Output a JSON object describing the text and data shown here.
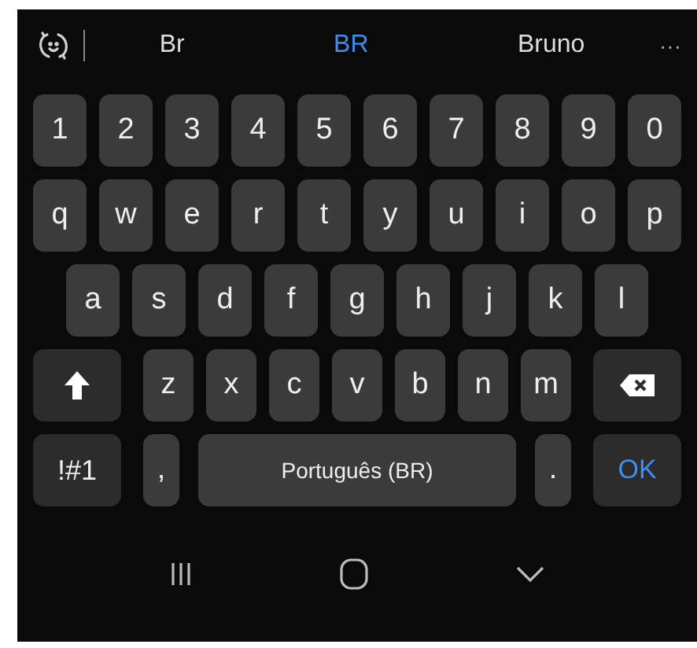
{
  "suggestions": [
    {
      "text": "Br",
      "selected": false
    },
    {
      "text": "BR",
      "selected": true
    },
    {
      "text": "Bruno",
      "selected": false
    }
  ],
  "more": "···",
  "rows": [
    {
      "indent": false,
      "keys": [
        {
          "kind": "char",
          "label": "1"
        },
        {
          "kind": "char",
          "label": "2"
        },
        {
          "kind": "char",
          "label": "3"
        },
        {
          "kind": "char",
          "label": "4"
        },
        {
          "kind": "char",
          "label": "5"
        },
        {
          "kind": "char",
          "label": "6"
        },
        {
          "kind": "char",
          "label": "7"
        },
        {
          "kind": "char",
          "label": "8"
        },
        {
          "kind": "char",
          "label": "9"
        },
        {
          "kind": "char",
          "label": "0"
        }
      ]
    },
    {
      "indent": false,
      "keys": [
        {
          "kind": "char",
          "label": "q"
        },
        {
          "kind": "char",
          "label": "w"
        },
        {
          "kind": "char",
          "label": "e"
        },
        {
          "kind": "char",
          "label": "r"
        },
        {
          "kind": "char",
          "label": "t"
        },
        {
          "kind": "char",
          "label": "y"
        },
        {
          "kind": "char",
          "label": "u"
        },
        {
          "kind": "char",
          "label": "i"
        },
        {
          "kind": "char",
          "label": "o"
        },
        {
          "kind": "char",
          "label": "p"
        }
      ]
    },
    {
      "indent": true,
      "keys": [
        {
          "kind": "char",
          "label": "a"
        },
        {
          "kind": "char",
          "label": "s"
        },
        {
          "kind": "char",
          "label": "d"
        },
        {
          "kind": "char",
          "label": "f"
        },
        {
          "kind": "char",
          "label": "g"
        },
        {
          "kind": "char",
          "label": "h"
        },
        {
          "kind": "char",
          "label": "j"
        },
        {
          "kind": "char",
          "label": "k"
        },
        {
          "kind": "char",
          "label": "l"
        }
      ]
    },
    {
      "indent": false,
      "keys": [
        {
          "kind": "shift"
        },
        {
          "kind": "char",
          "label": "z"
        },
        {
          "kind": "char",
          "label": "x"
        },
        {
          "kind": "char",
          "label": "c"
        },
        {
          "kind": "char",
          "label": "v"
        },
        {
          "kind": "char",
          "label": "b"
        },
        {
          "kind": "char",
          "label": "n"
        },
        {
          "kind": "char",
          "label": "m"
        },
        {
          "kind": "backspace"
        }
      ]
    },
    {
      "indent": false,
      "keys": [
        {
          "kind": "symbols",
          "label": "!#1"
        },
        {
          "kind": "char",
          "label": ","
        },
        {
          "kind": "space",
          "label": "Português (BR)"
        },
        {
          "kind": "char",
          "label": "."
        },
        {
          "kind": "enter",
          "label": "OK"
        }
      ]
    }
  ]
}
